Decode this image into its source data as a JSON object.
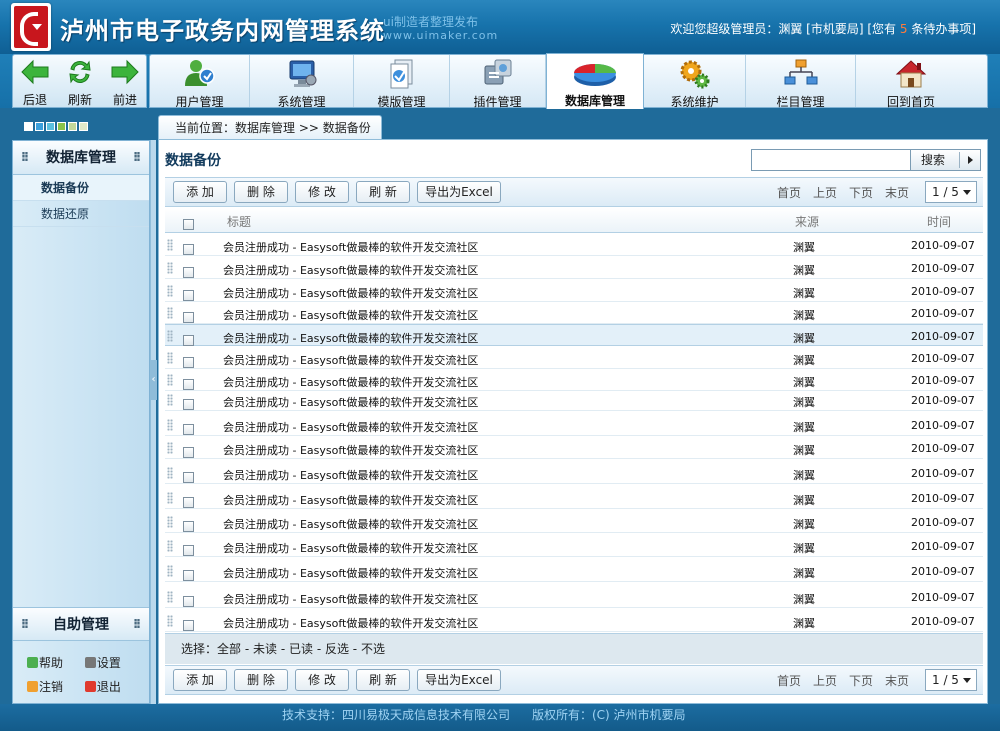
{
  "header": {
    "title": "泸州市电子政务内网管理系统",
    "watermark_line1": "ui制造者整理发布",
    "watermark_line2": "www.uimaker.com",
    "welcome_prefix": "欢迎您超级管理员：渊翼 [市机要局] [您有",
    "pending_count": "5",
    "welcome_suffix": "条待办事项]"
  },
  "nav": {
    "back": "后退",
    "refresh": "刷新",
    "forward": "前进"
  },
  "tabs": [
    {
      "label": "用户管理",
      "icon": "users-icon"
    },
    {
      "label": "系统管理",
      "icon": "monitor-gear-icon"
    },
    {
      "label": "模版管理",
      "icon": "template-icon"
    },
    {
      "label": "插件管理",
      "icon": "plugin-icon"
    },
    {
      "label": "数据库管理",
      "icon": "database-pie-icon",
      "active": true
    },
    {
      "label": "系统维护",
      "icon": "gears-icon"
    },
    {
      "label": "栏目管理",
      "icon": "sitemap-icon"
    },
    {
      "label": "回到首页",
      "icon": "home-icon"
    }
  ],
  "skin_colors": [
    "#ffffff",
    "#3aa0dc",
    "#5bc0de",
    "#8bc34a",
    "#c3d99b",
    "#dfe9c9"
  ],
  "sidebar": {
    "section_title": "数据库管理",
    "items": [
      {
        "label": "数据备份",
        "current": true
      },
      {
        "label": "数据还原",
        "current": false
      }
    ],
    "self_title": "自助管理",
    "help": "帮助",
    "settings": "设置",
    "logout": "注销",
    "exit": "退出"
  },
  "breadcrumb": "当前位置：数据库管理 >> 数据备份",
  "main": {
    "title": "数据备份",
    "search_value": "",
    "search_button": "搜索",
    "actions": {
      "add": "添 加",
      "delete": "删 除",
      "edit": "修 改",
      "refresh": "刷 新",
      "export": "导出为Excel"
    },
    "pager": {
      "first": "首页",
      "prev": "上页",
      "next": "下页",
      "last": "末页",
      "current": "1 / 5"
    },
    "columns": {
      "title": "标题",
      "source": "来源",
      "time": "时间"
    },
    "rows": [
      {
        "title": "会员注册成功 - Easysoft做最棒的软件开发交流社区",
        "source": "渊翼",
        "time": "2010-09-07"
      },
      {
        "title": "会员注册成功 - Easysoft做最棒的软件开发交流社区",
        "source": "渊翼",
        "time": "2010-09-07"
      },
      {
        "title": "会员注册成功 - Easysoft做最棒的软件开发交流社区",
        "source": "渊翼",
        "time": "2010-09-07"
      },
      {
        "title": "会员注册成功 - Easysoft做最棒的软件开发交流社区",
        "source": "渊翼",
        "time": "2010-09-07"
      },
      {
        "title": "会员注册成功 - Easysoft做最棒的软件开发交流社区",
        "source": "渊翼",
        "time": "2010-09-07",
        "highlight": true
      },
      {
        "title": "会员注册成功 - Easysoft做最棒的软件开发交流社区",
        "source": "渊翼",
        "time": "2010-09-07"
      },
      {
        "title": "会员注册成功 - Easysoft做最棒的软件开发交流社区",
        "source": "渊翼",
        "time": "2010-09-07"
      },
      {
        "title": "会员注册成功 - Easysoft做最棒的软件开发交流社区",
        "source": "渊翼",
        "time": "2010-09-07"
      },
      {
        "title": "会员注册成功 - Easysoft做最棒的软件开发交流社区",
        "source": "渊翼",
        "time": "2010-09-07"
      },
      {
        "title": "会员注册成功 - Easysoft做最棒的软件开发交流社区",
        "source": "渊翼",
        "time": "2010-09-07"
      },
      {
        "title": "会员注册成功 - Easysoft做最棒的软件开发交流社区",
        "source": "渊翼",
        "time": "2010-09-07"
      },
      {
        "title": "会员注册成功 - Easysoft做最棒的软件开发交流社区",
        "source": "渊翼",
        "time": "2010-09-07"
      },
      {
        "title": "会员注册成功 - Easysoft做最棒的软件开发交流社区",
        "source": "渊翼",
        "time": "2010-09-07"
      },
      {
        "title": "会员注册成功 - Easysoft做最棒的软件开发交流社区",
        "source": "渊翼",
        "time": "2010-09-07"
      },
      {
        "title": "会员注册成功 - Easysoft做最棒的软件开发交流社区",
        "source": "渊翼",
        "time": "2010-09-07"
      },
      {
        "title": "会员注册成功 - Easysoft做最棒的软件开发交流社区",
        "source": "渊翼",
        "time": "2010-09-07"
      },
      {
        "title": "会员注册成功 - Easysoft做最棒的软件开发交流社区",
        "source": "渊翼",
        "time": "2010-09-07"
      }
    ],
    "selection": {
      "label": "选择：",
      "all": "全部",
      "unread": "未读",
      "read": "已读",
      "invert": "反选",
      "none": "不选"
    }
  },
  "footer": {
    "support": "技术支持：四川易极天成信息技术有限公司",
    "copyright": "版权所有：(C) 泸州市机要局"
  }
}
